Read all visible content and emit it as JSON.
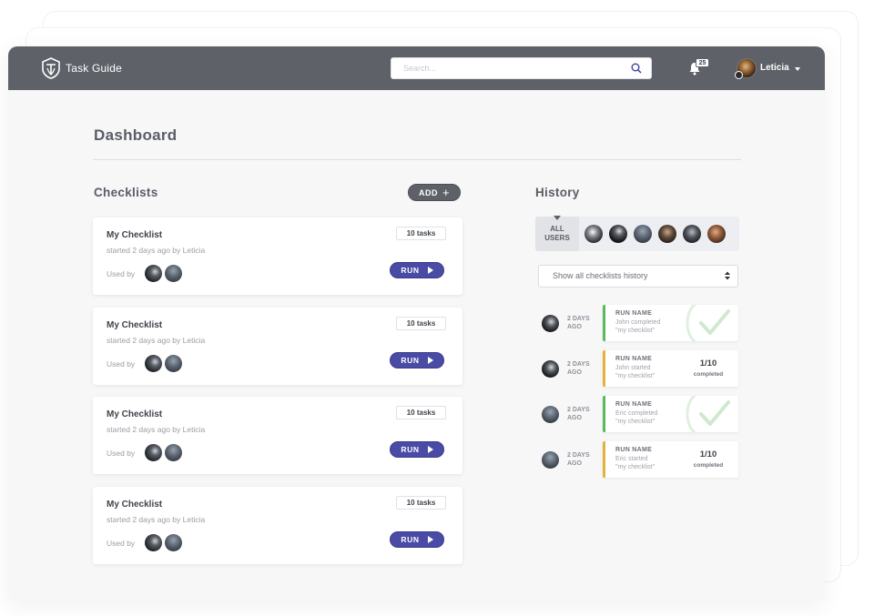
{
  "header": {
    "app_title": "Task Guide",
    "search_placeholder": "Search...",
    "notification_count": "25",
    "user_name": "Leticia"
  },
  "page": {
    "title": "Dashboard"
  },
  "checklists": {
    "section_title": "Checklists",
    "add_label": "ADD",
    "items": [
      {
        "name": "My Checklist",
        "meta": "started 2 days ago by Leticia",
        "tasks": "10 tasks",
        "used_by": "Used by",
        "run_label": "RUN"
      },
      {
        "name": "My Checklist",
        "meta": "started 2 days ago by Leticia",
        "tasks": "10 tasks",
        "used_by": "Used by",
        "run_label": "RUN"
      },
      {
        "name": "My Checklist",
        "meta": "started 2 days ago by Leticia",
        "tasks": "10 tasks",
        "used_by": "Used by",
        "run_label": "RUN"
      },
      {
        "name": "My Checklist",
        "meta": "started 2 days ago by Leticia",
        "tasks": "10 tasks",
        "used_by": "Used by",
        "run_label": "RUN"
      }
    ]
  },
  "history": {
    "section_title": "History",
    "all_users_line1": "ALL",
    "all_users_line2": "USERS",
    "filter_select": "Show all checklists history",
    "entries": [
      {
        "when1": "2 DAYS",
        "when2": "AGO",
        "run_name": "RUN NAME",
        "line2": "John completed",
        "line3": "\"my checklist\"",
        "status": "completed",
        "status_color": "#5cb85c"
      },
      {
        "when1": "2 DAYS",
        "when2": "AGO",
        "run_name": "RUN NAME",
        "line2": "John started",
        "line3": "\"my checklist\"",
        "status": "in-progress",
        "status_color": "#e0b43a",
        "progress": "1/10",
        "progress_label": "completed"
      },
      {
        "when1": "2 DAYS",
        "when2": "AGO",
        "run_name": "RUN NAME",
        "line2": "Eric completed",
        "line3": "\"my checklist\"",
        "status": "completed",
        "status_color": "#5cb85c"
      },
      {
        "when1": "2 DAYS",
        "when2": "AGO",
        "run_name": "RUN NAME",
        "line2": "Eric started",
        "line3": "\"my checklist\"",
        "status": "in-progress",
        "status_color": "#e0b43a",
        "progress": "1/10",
        "progress_label": "completed"
      }
    ]
  },
  "colors": {
    "topbar": "#5e6168",
    "run_button": "#4a4ba5",
    "completed": "#5cb85c",
    "in_progress": "#e0b43a"
  }
}
